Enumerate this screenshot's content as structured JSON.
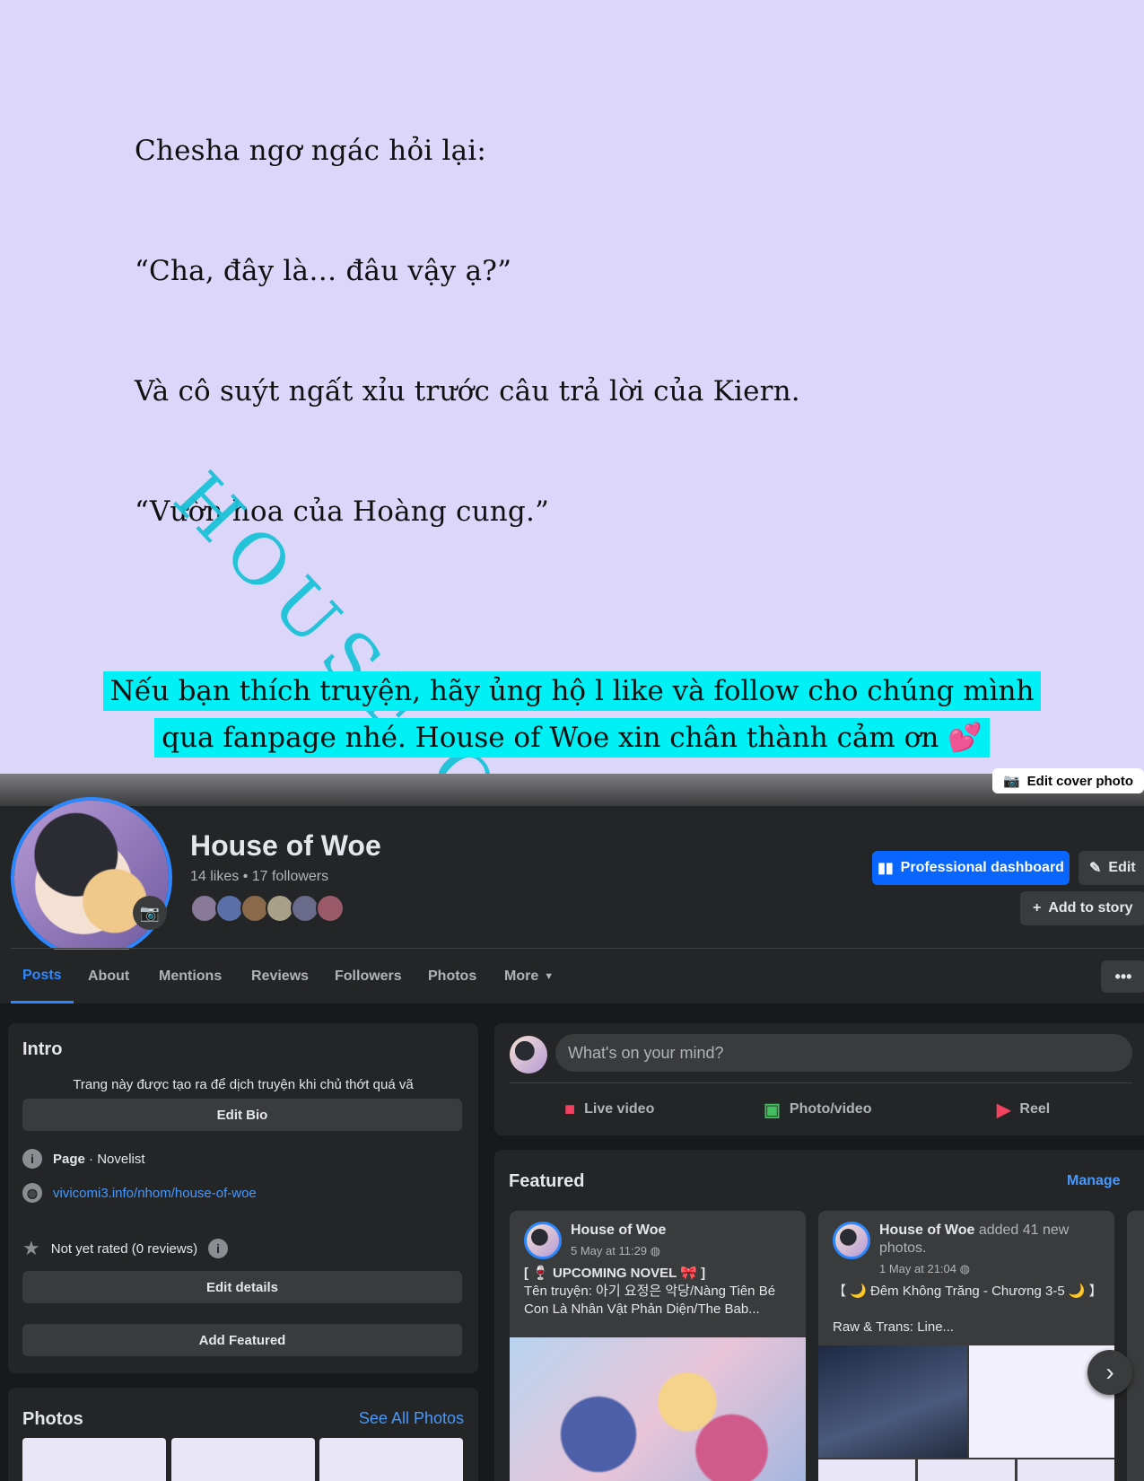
{
  "comic": {
    "lines": [
      "Chesha ngơ ngác hỏi lại:",
      "“Cha, đây là… đâu vậy ạ?”",
      "Và cô suýt ngất xỉu trước câu trả lời của Kiern.",
      "“Vườn hoa của Hoàng cung.”"
    ],
    "watermark": "HOUSE OF",
    "promo_line1": "Nếu bạn thích truyện, hãy ủng hộ l like và follow cho chúng mình",
    "promo_line2": "qua fanpage nhé. House of Woe xin chân thành cảm ơn",
    "promo_emoji": "💕"
  },
  "cover": {
    "edit_cover_label": "Edit cover photo"
  },
  "profile": {
    "name": "House of Woe",
    "stats": "14 likes • 17 followers",
    "professional_dashboard_label": "Professional dashboard",
    "edit_label": "Edit",
    "add_story_label": "Add to story",
    "follower_face_colors": [
      "#8a7a9a",
      "#5a6fa8",
      "#8a6a4a",
      "#a8a088",
      "#6a6a8a",
      "#9a5a6a"
    ]
  },
  "tabs": [
    "Posts",
    "About",
    "Mentions",
    "Reviews",
    "Followers",
    "Photos",
    "More"
  ],
  "more_menu_label": "•••",
  "intro": {
    "title": "Intro",
    "bio": "Trang này được tạo ra để dịch truyện khi chủ thớt quá vã",
    "edit_bio": "Edit Bio",
    "category": "Page · Novelist",
    "category_bold": "Page",
    "category_rest": " · Novelist",
    "website": "vivicomi3.info/nhom/house-of-woe",
    "rating": "Not yet rated (0 reviews)",
    "edit_details": "Edit details",
    "add_featured": "Add Featured"
  },
  "photos": {
    "title": "Photos",
    "see_all": "See All Photos"
  },
  "composer": {
    "placeholder": "What's on your mind?",
    "live_video": "Live video",
    "photo_video": "Photo/video",
    "reel": "Reel"
  },
  "featured": {
    "title": "Featured",
    "manage": "Manage",
    "posts": [
      {
        "author": "House of Woe",
        "action": "",
        "time": "5 May at 11:29",
        "text_line1": "[ 🍷 UPCOMING NOVEL 🎀 ]",
        "text_line2": "Tên truyện: 아기 요정은 악당/Nàng Tiên Bé Con Là Nhân Vật Phản Diện/The Bab..."
      },
      {
        "author": "House of Woe",
        "action": " added 41 new photos.",
        "time": "1 May at 21:04",
        "text_line1": "【 🌙 Đêm Không Trăng - Chương 3-5 🌙 】",
        "text_line2": "Raw & Trans: Line..."
      }
    ]
  },
  "icons": {
    "globe": "🌐",
    "next": "›"
  }
}
